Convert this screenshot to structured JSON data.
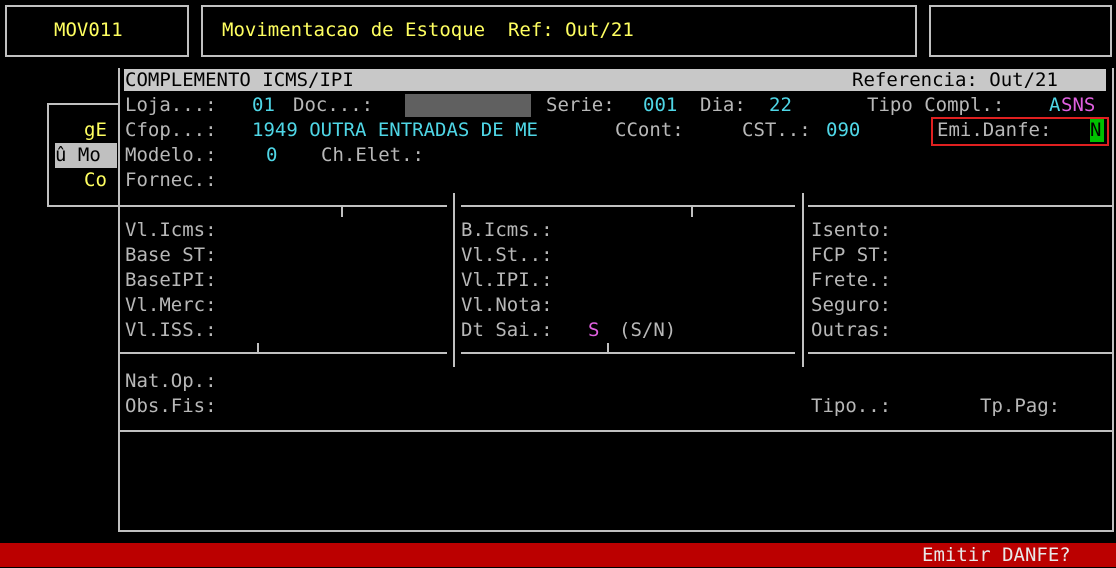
{
  "header": {
    "program_code": "MOV011",
    "title": "Movimentacao de Estoque  Ref: Out/21"
  },
  "background_menu": {
    "line1": "gE",
    "line2": "û Mo",
    "line3": "Co"
  },
  "dialog": {
    "title": "COMPLEMENTO ICMS/IPI",
    "reference": "Referencia: Out/21",
    "loja_label": "Loja...:",
    "loja_value": "01",
    "doc_label": "Doc...:",
    "serie_label": "Serie:",
    "serie_value": "001",
    "dia_label": "Dia:",
    "dia_value": "22",
    "tipo_compl_label": "Tipo Compl.:",
    "tipo_compl_value_a": "A",
    "tipo_compl_value_b": "SNS",
    "cfop_label": "Cfop...:",
    "cfop_value": "1949 OUTRA ENTRADAS DE ME",
    "ccont_label": "CCont:",
    "cst_label": "CST..:",
    "cst_value": "090",
    "emi_danfe_label": "Emi.Danfe:",
    "emi_danfe_value": "N",
    "modelo_label": "Modelo.:",
    "modelo_value": "0",
    "ch_elet_label": "Ch.Elet.:",
    "fornec_label": "Fornec.:"
  },
  "values_grid": {
    "col1": [
      "Vl.Icms:",
      "Base ST:",
      "BaseIPI:",
      "Vl.Merc:",
      "Vl.ISS.:"
    ],
    "col2": [
      "B.Icms.:",
      "Vl.St..:",
      "Vl.IPI.:",
      "Vl.Nota:"
    ],
    "dt_sai_label": "Dt Sai.:",
    "dt_sai_value": "S",
    "dt_sai_hint": "(S/N)",
    "col3": [
      "Isento:",
      "FCP ST:",
      "Frete.:",
      "Seguro:",
      "Outras:"
    ]
  },
  "footer_fields": {
    "nat_op_label": "Nat.Op.:",
    "obs_fis_label": "Obs.Fis:",
    "tipo_label": "Tipo..:",
    "tp_pag_label": "Tp.Pag:"
  },
  "status_bar": {
    "prompt": "Emitir DANFE?"
  },
  "colors": {
    "background": "#000000",
    "label_gray": "#b8b8b8",
    "value_cyan": "#4fd6e6",
    "header_yellow": "#ffff60",
    "magenta": "#e060e0",
    "status_bar_red": "#bb0000",
    "cursor_green": "#00c000",
    "highlight_red": "#e02020"
  }
}
